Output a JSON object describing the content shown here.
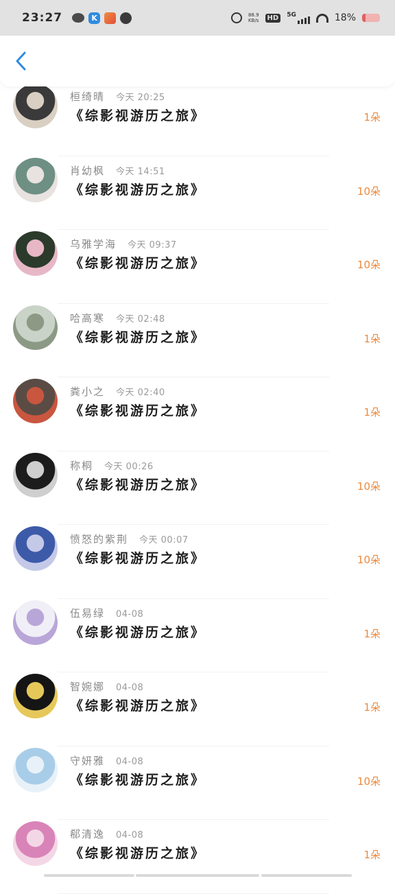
{
  "status_bar": {
    "time": "23:27",
    "net_speed": "88.9",
    "net_unit": "KB/s",
    "hd": "HD",
    "network": "5G",
    "battery": "18%"
  },
  "header": {
    "back_icon": "chevron-left-icon",
    "accent": "#2f8be0"
  },
  "list": [
    {
      "name": "桓绮晴",
      "time": "今天 20:25",
      "title": "《综影视游历之旅》",
      "amount": "1朵",
      "avatar": [
        "#3a3a3a",
        "#d9cfc2"
      ]
    },
    {
      "name": "肖幼枫",
      "time": "今天 14:51",
      "title": "《综影视游历之旅》",
      "amount": "10朵",
      "avatar": [
        "#6e8f84",
        "#e8e2e0"
      ]
    },
    {
      "name": "乌雅学海",
      "time": "今天 09:37",
      "title": "《综影视游历之旅》",
      "amount": "10朵",
      "avatar": [
        "#2b3a2a",
        "#e7b7c6"
      ]
    },
    {
      "name": "哈高寒",
      "time": "今天 02:48",
      "title": "《综影视游历之旅》",
      "amount": "1朵",
      "avatar": [
        "#c9d3c8",
        "#8c9a85"
      ]
    },
    {
      "name": "粪小之",
      "time": "今天 02:40",
      "title": "《综影视游历之旅》",
      "amount": "1朵",
      "avatar": [
        "#5a4c45",
        "#c9563f"
      ]
    },
    {
      "name": "称桐",
      "time": "今天 00:26",
      "title": "《综影视游历之旅》",
      "amount": "10朵",
      "avatar": [
        "#1c1c1c",
        "#cfcfcf"
      ]
    },
    {
      "name": "愤怒的紫荆",
      "time": "今天 00:07",
      "title": "《综影视游历之旅》",
      "amount": "10朵",
      "avatar": [
        "#3c5aa8",
        "#c5c9e8"
      ]
    },
    {
      "name": "伍易绿",
      "time": "04-08",
      "title": "《综影视游历之旅》",
      "amount": "1朵",
      "avatar": [
        "#f0eef6",
        "#b9a6d8"
      ]
    },
    {
      "name": "智婉娜",
      "time": "04-08",
      "title": "《综影视游历之旅》",
      "amount": "1朵",
      "avatar": [
        "#151515",
        "#e6c85a"
      ]
    },
    {
      "name": "守妍雅",
      "time": "04-08",
      "title": "《综影视游历之旅》",
      "amount": "10朵",
      "avatar": [
        "#a8cde8",
        "#e8f1f8"
      ]
    },
    {
      "name": "郗清逸",
      "time": "04-08",
      "title": "《综影视游历之旅》",
      "amount": "1朵",
      "avatar": [
        "#d984b8",
        "#f4d7e6"
      ]
    }
  ],
  "colors": {
    "amount": "#ec8a3e",
    "title": "#1e1e1e",
    "name": "#8a8a8a"
  }
}
